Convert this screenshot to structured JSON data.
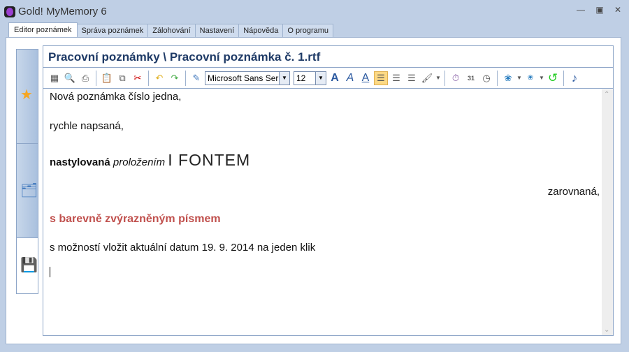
{
  "window": {
    "title": "Gold! MyMemory 6"
  },
  "tabs": [
    {
      "label": "Editor poznámek",
      "active": true
    },
    {
      "label": "Správa poznámek"
    },
    {
      "label": "Zálohování"
    },
    {
      "label": "Nastavení"
    },
    {
      "label": "Nápověda"
    },
    {
      "label": "O programu"
    }
  ],
  "sidebar": {
    "items": [
      {
        "icon": "star-icon"
      },
      {
        "icon": "folder-icon"
      },
      {
        "icon": "save-icon",
        "selected": true
      }
    ]
  },
  "editor": {
    "title": "Pracovní poznámky \\ Pracovní poznámka č. 1.rtf",
    "toolbar": {
      "font": "Microsoft Sans Seri",
      "size": "12"
    },
    "lines": {
      "l1": "Nová poznámka číslo jedna,",
      "l2": "rychle napsaná,",
      "l3_bold": "nastylovaná",
      "l3_italic": "proložením",
      "l3_font": "I FONTEM",
      "l4": "zarovnaná,",
      "l5": "s barevně zvýrazněným písmem",
      "l6": "s možností vložit aktuální datum 19. 9. 2014 na jeden klik"
    },
    "colors": {
      "highlight_text": "#c0504d",
      "title": "#1e3a66"
    }
  }
}
